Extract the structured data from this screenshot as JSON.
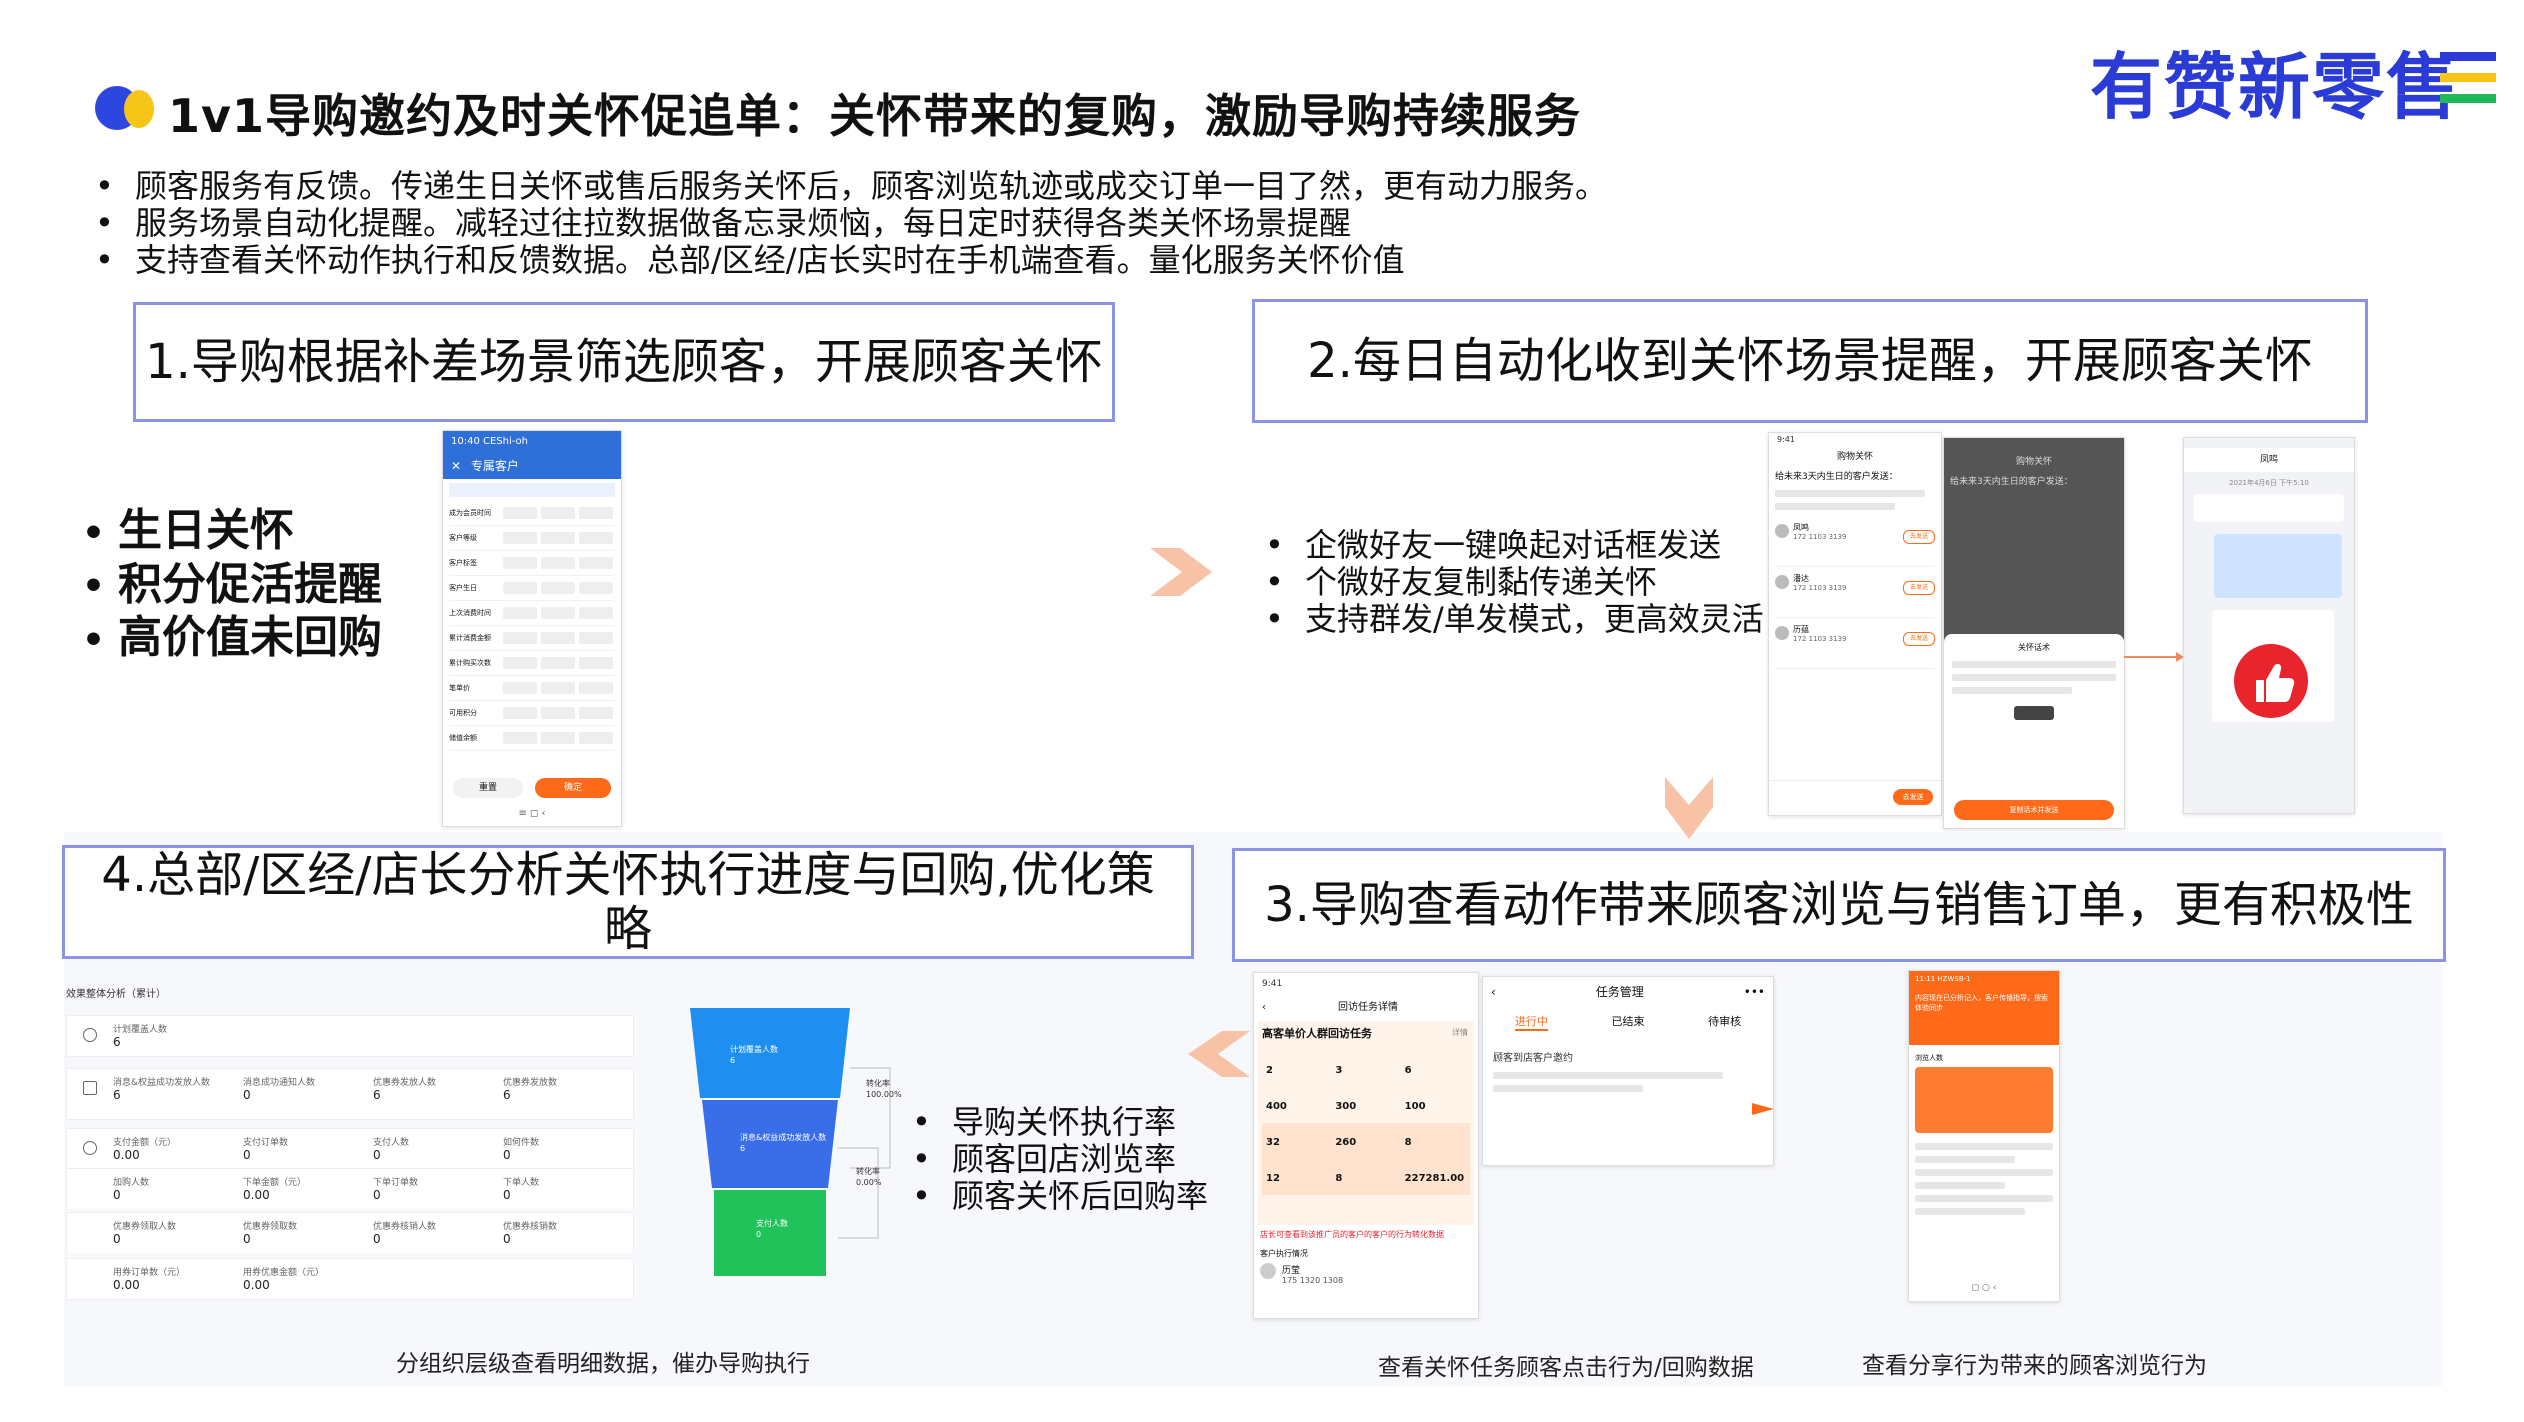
{
  "header": {
    "title": "1v1导购邀约及时关怀促追单：关怀带来的复购，激励导购持续服务",
    "logo_text": "有赞新零售",
    "logo_bar_colors": [
      "#2a3bd6",
      "#f5c518",
      "#1fb85b"
    ]
  },
  "intro_bullets": [
    "顾客服务有反馈。传递生日关怀或售后服务关怀后，顾客浏览轨迹或成交订单一目了然，更有动力服务。",
    "服务场景自动化提醒。减轻过往拉数据做备忘录烦恼，每日定时获得各类关怀场景提醒",
    "支持查看关怀动作执行和反馈数据。总部/区经/店长实时在手机端查看。量化服务关怀价值"
  ],
  "steps": {
    "step1": "1.导购根据补差场景筛选顾客，开展顾客关怀",
    "step2": "2.每日自动化收到关怀场景提醒，开展顾客关怀",
    "step3": "3.导购查看动作带来顾客浏览与销售订单，更有积极性",
    "step4_line1": "4.总部/区经/店长分析关怀执行进度与回购,优化策",
    "step4_line2": "略"
  },
  "step1_points": [
    "生日关怀",
    "积分促活提醒",
    "高价值未回购"
  ],
  "step2_points": [
    "企微好友一键唤起对话框发送",
    "个微好友复制黏传递关怀",
    "支持群发/单发模式，更高效灵活"
  ],
  "step4_points": [
    "导购关怀执行率",
    "顾客回店浏览率",
    "顾客关怀后回购率"
  ],
  "captions": {
    "left": "分组织层级查看明细数据，催办导购执行",
    "mid": "查看关怀任务顾客点击行为/回购数据",
    "right": "查看分享行为带来的顾客浏览行为"
  },
  "filter_phone": {
    "status": "10:40 CEShi-oh",
    "nav_title": "专属客户",
    "rows": [
      "成为会员时间",
      "客户等级",
      "客户标签",
      "客户生日",
      "上次消费时间",
      "累计消费金额",
      "累计购买次数",
      "笔单价",
      "可用积分",
      "储值余额"
    ],
    "buttons": [
      "重置",
      "确定"
    ]
  },
  "care_phones": {
    "title": "购物关怀",
    "subtitle": "给未来3天内生日的客户发送：",
    "customers": [
      {
        "name": "凤鸣",
        "phone": "172 1103 3139"
      },
      {
        "name": "潘达",
        "phone": "172 1103 3139"
      },
      {
        "name": "历蕴",
        "phone": "172 1103 3139"
      }
    ],
    "send_label": "去发送",
    "popup_title": "关怀话术",
    "confirm_label": "复制话术并发送",
    "chat_title": "凤鸣",
    "chat_time": "2021年4月6日 下午5:10"
  },
  "stats": {
    "heading": "效果整体分析（累计）",
    "rows": [
      [
        {
          "label": "计划覆盖人数",
          "value": "6"
        }
      ],
      [
        {
          "label": "消息&权益成功发放人数",
          "value": "6"
        },
        {
          "label": "消息成功通知人数",
          "value": "0"
        },
        {
          "label": "优惠券发放人数",
          "value": "6"
        },
        {
          "label": "优惠券发放数",
          "value": "6"
        }
      ],
      [
        {
          "label": "支付金额（元）",
          "value": "0.00"
        },
        {
          "label": "支付订单数",
          "value": "0"
        },
        {
          "label": "支付人数",
          "value": "0"
        },
        {
          "label": "如何件数",
          "value": "0"
        }
      ],
      [
        {
          "label": "加购人数",
          "value": "0"
        },
        {
          "label": "下单金额（元）",
          "value": "0.00"
        },
        {
          "label": "下单订单数",
          "value": "0"
        },
        {
          "label": "下单人数",
          "value": "0"
        }
      ],
      [
        {
          "label": "优惠券领取人数",
          "value": "0"
        },
        {
          "label": "优惠券领取数",
          "value": "0"
        },
        {
          "label": "优惠券核销人数",
          "value": "0"
        },
        {
          "label": "优惠券核销数",
          "value": "0"
        }
      ],
      [
        {
          "label": "用券订单数（元）",
          "value": "0.00"
        },
        {
          "label": "用券优惠金额（元）",
          "value": "0.00"
        }
      ]
    ]
  },
  "funnel": {
    "stages": [
      {
        "label": "计划覆盖人数",
        "value": "6",
        "color": "#1e8ff0"
      },
      {
        "label": "消息&权益成功发放人数",
        "value": "6",
        "color": "#3a6ee8"
      },
      {
        "label": "支付人数",
        "value": "0",
        "color": "#22c25a"
      }
    ],
    "conversions": [
      {
        "label": "转化率",
        "value": "100.00%"
      },
      {
        "label": "转化率",
        "value": "0.00%"
      }
    ]
  },
  "task_phone": {
    "status": "9:41",
    "nav_title": "回访任务详情",
    "task_name": "高客单价人群回访任务",
    "detail": "详情",
    "metrics": [
      [
        "2",
        "3",
        "6"
      ],
      [
        "400",
        "300",
        "100"
      ],
      [
        "32",
        "260",
        "8"
      ],
      [
        "12",
        "8",
        "227281.00"
      ]
    ],
    "note": "店长可查看到该推广员的客户的客户的行为转化数据",
    "list_title": "客户执行情况",
    "customer_name": "历莹",
    "customer_phone": "175 1320 1308"
  },
  "task_manage": {
    "nav_title": "任务管理",
    "tabs": [
      "进行中",
      "已结束",
      "待审核"
    ],
    "item": "顾客到店客户邀约"
  },
  "share_phone": {
    "status": "11:11 HZWSB-1",
    "banner": "内容现在已分析记入，客户传播指导，搜索体验同步",
    "card_title": "浏览人数"
  }
}
